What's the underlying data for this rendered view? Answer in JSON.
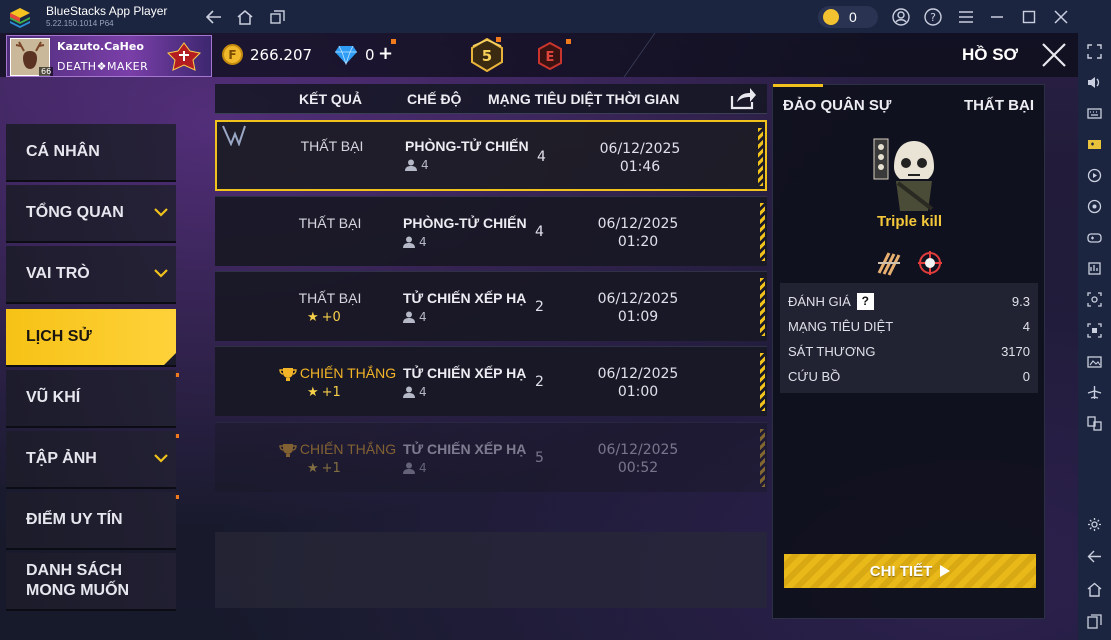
{
  "window": {
    "app_title": "BlueStacks App Player",
    "version": "5.22.150.1014  P64",
    "coins": "0"
  },
  "header": {
    "player_name": "Kazuto.CaHeo",
    "guild_name": "DEATH❖MAKER",
    "avatar_level": "66",
    "gold": "266.207",
    "diamonds": "0",
    "diamond_plus": "+",
    "level_badge": "5",
    "elite_badge": "E",
    "page_title": "HỒ SƠ"
  },
  "menu": [
    {
      "label": "CÁ NHÂN",
      "active": false,
      "chevron": false
    },
    {
      "label": "TỔNG QUAN",
      "active": false,
      "chevron": true
    },
    {
      "label": "VAI TRÒ",
      "active": false,
      "chevron": true
    },
    {
      "label": "LỊCH SỬ",
      "active": true,
      "chevron": false
    },
    {
      "label": "VŨ KHÍ",
      "active": false,
      "chevron": false
    },
    {
      "label": "TẬP ẢNH",
      "active": false,
      "chevron": true
    },
    {
      "label": "ĐIỂM UY TÍN",
      "active": false,
      "chevron": false
    },
    {
      "label_line1": "DANH SÁCH",
      "label_line2": "MONG MUỐN",
      "active": false,
      "chevron": false
    }
  ],
  "table": {
    "columns": [
      "KẾT QUẢ",
      "CHẾ ĐỘ",
      "MẠNG TIÊU DIỆT",
      "THỜI GIAN"
    ],
    "rows": [
      {
        "result": "THẤT BẠI",
        "win": false,
        "points": "",
        "mode": "PHÒNG-TỬ CHIẾN",
        "players": "4",
        "kills": "4",
        "date": "06/12/2025",
        "time": "01:46",
        "selected": true
      },
      {
        "result": "THẤT BẠI",
        "win": false,
        "points": "",
        "mode": "PHÒNG-TỬ CHIẾN",
        "players": "4",
        "kills": "4",
        "date": "06/12/2025",
        "time": "01:20",
        "selected": false
      },
      {
        "result": "THẤT BẠI",
        "win": false,
        "points": "+0",
        "mode": "TỬ CHIẾN XẾP HẠ",
        "players": "4",
        "kills": "2",
        "date": "06/12/2025",
        "time": "01:09",
        "selected": false
      },
      {
        "result": "CHIẾN THẮNG",
        "win": true,
        "points": "+1",
        "mode": "TỬ CHIẾN XẾP HẠ",
        "players": "4",
        "kills": "2",
        "date": "06/12/2025",
        "time": "01:00",
        "selected": false
      },
      {
        "result": "CHIẾN THẮNG",
        "win": true,
        "points": "+1",
        "mode": "TỬ CHIẾN XẾP HẠ",
        "players": "4",
        "kills": "5",
        "date": "06/12/2025",
        "time": "00:52",
        "selected": false
      }
    ]
  },
  "detail": {
    "map_name": "ĐẢO QUÂN SỰ",
    "result": "THẤT BẠI",
    "achievement": "Triple kill",
    "stats": [
      {
        "label": "ĐÁNH GIÁ",
        "value": "9.3",
        "help": true
      },
      {
        "label": "MẠNG TIÊU DIỆT",
        "value": "4",
        "help": false
      },
      {
        "label": "SÁT THƯƠNG",
        "value": "3170",
        "help": false
      },
      {
        "label": "CỨU BỒ",
        "value": "0",
        "help": false
      }
    ],
    "button": "CHI TIẾT"
  },
  "colors": {
    "accent": "#f2c21c",
    "win": "#f3b427",
    "panel": "#161a2c"
  }
}
